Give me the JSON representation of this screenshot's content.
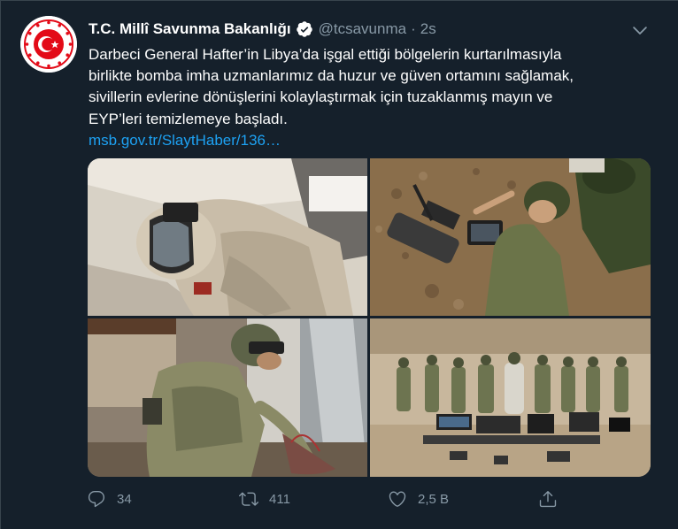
{
  "author": {
    "display_name": "T.C. Millî Savunma Bakanlığı",
    "handle": "@tcsavunma",
    "separator": "·",
    "time": "2s",
    "avatar_icon": "crescent-star-emblem-icon"
  },
  "tweet": {
    "lines": [
      "Darbeci General Hafter’in Libya’da işgal ettiği bölgelerin kurtarılmasıyla",
      "birlikte bomba imha uzmanlarımız da huzur ve güven ortamını sağlamak,",
      "sivillerin evlerine dönüşlerini kolaylaştırmak için tuzaklanmış mayın ve",
      "EYP’leri temizlemeye başladı."
    ],
    "link": "msb.gov.tr/SlaytHaber/136…"
  },
  "media": {
    "photos": [
      {
        "icon": "photo-bomb-suit-technician"
      },
      {
        "icon": "photo-soldiers-with-robot"
      },
      {
        "icon": "photo-soldier-defusing-device"
      },
      {
        "icon": "photo-team-with-equipment"
      }
    ]
  },
  "actions": {
    "reply_count": "34",
    "retweet_count": "411",
    "like_count": "2,5 B"
  },
  "colors": {
    "background": "#15202b",
    "text_primary": "#ffffff",
    "text_secondary": "#8899a6",
    "link": "#1da1f2",
    "verified_badge": "#ffffff",
    "avatar_red": "#e30a17"
  }
}
